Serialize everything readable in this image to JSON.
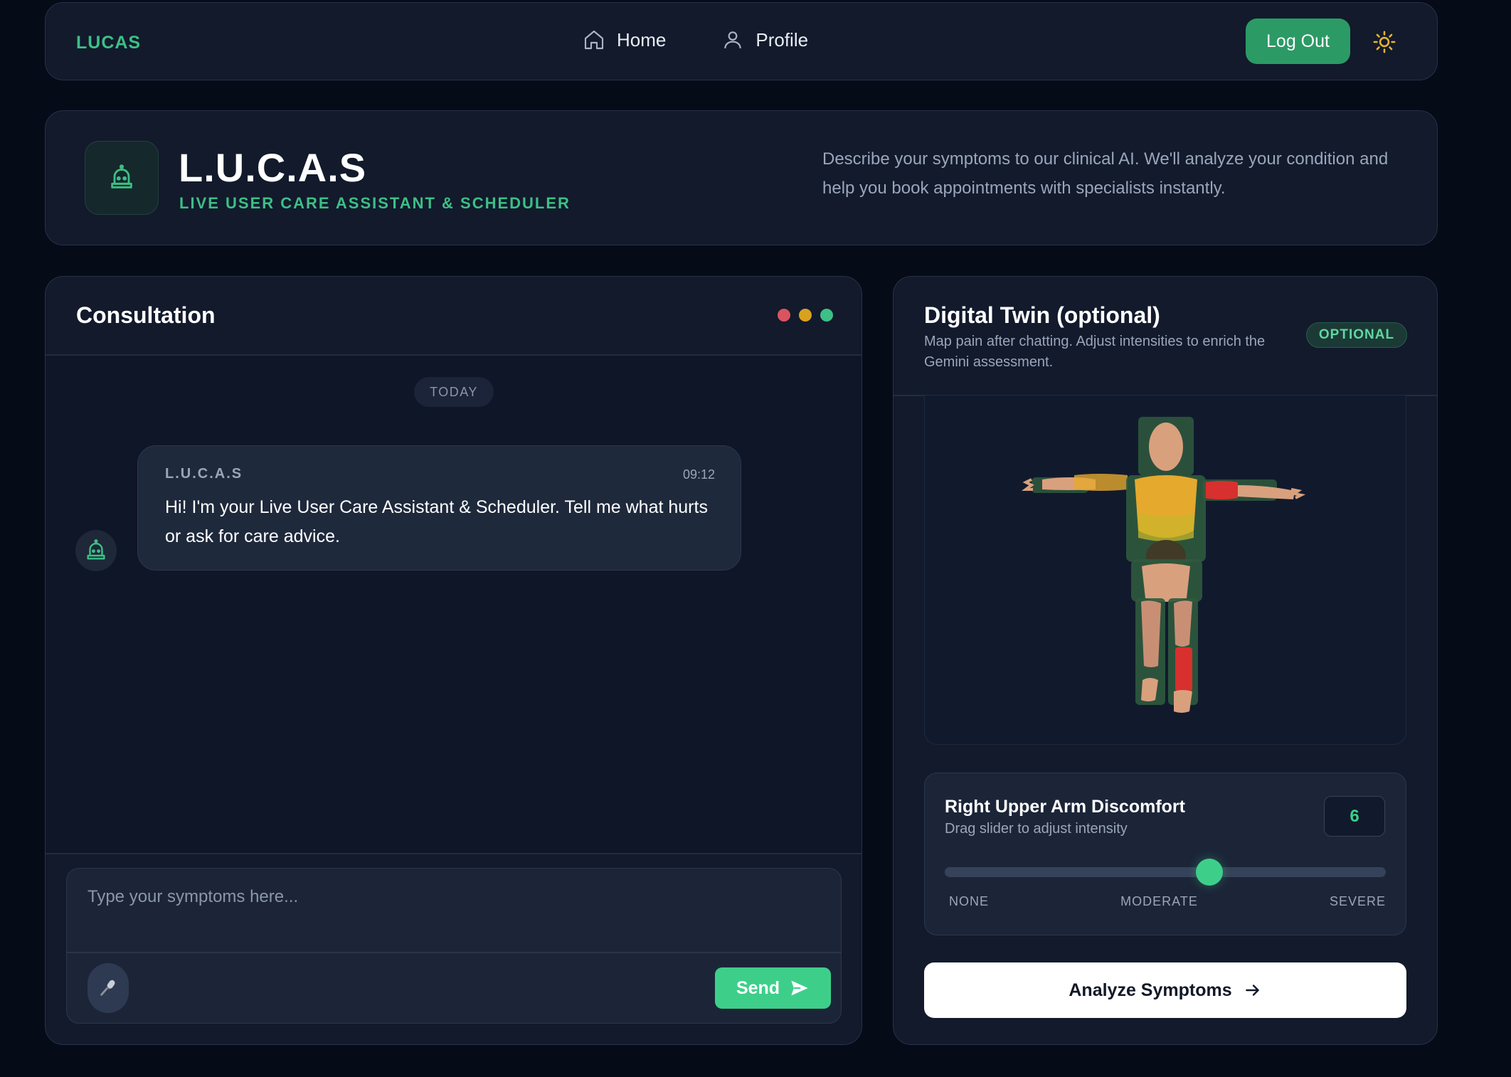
{
  "nav": {
    "brand": "LUCAS",
    "links": [
      {
        "label": "Home",
        "icon": "home-icon"
      },
      {
        "label": "Profile",
        "icon": "user-icon"
      }
    ],
    "logout_label": "Log Out",
    "theme_icon": "sun-icon"
  },
  "hero": {
    "icon": "robot-icon",
    "title": "L.U.C.A.S",
    "subtitle": "LIVE USER CARE ASSISTANT & SCHEDULER",
    "description": "Describe your symptoms to our clinical AI. We'll analyze your condition and help you book appointments with specialists instantly."
  },
  "consultation": {
    "title": "Consultation",
    "window_dots": [
      "#d9545e",
      "#d9a21e",
      "#3dbf86"
    ],
    "date_chip": "TODAY",
    "messages": [
      {
        "sender": "L.U.C.A.S",
        "time": "09:12",
        "text": "Hi! I'm your Live User Care Assistant & Scheduler. Tell me what hurts or ask for care advice."
      }
    ],
    "input_placeholder": "Type your symptoms here...",
    "mic_icon": "microphone-icon",
    "send_label": "Send"
  },
  "twin": {
    "title": "Digital Twin (optional)",
    "subtitle": "Map pain after chatting. Adjust intensities to enrich the Gemini assessment.",
    "badge": "OPTIONAL",
    "control": {
      "region": "Right Upper Arm Discomfort",
      "hint": "Drag slider to adjust intensity",
      "value": "6",
      "level_fraction": 0.6,
      "scale_labels": [
        "NONE",
        "MODERATE",
        "SEVERE"
      ]
    },
    "analyze_label": "Analyze Symptoms"
  },
  "colors": {
    "accent": "#3dbf86",
    "button_green": "#2c9a65",
    "send_green": "#3dcf8a",
    "pain_severe": "#d8302e",
    "pain_moderate": "#e5a92e"
  }
}
